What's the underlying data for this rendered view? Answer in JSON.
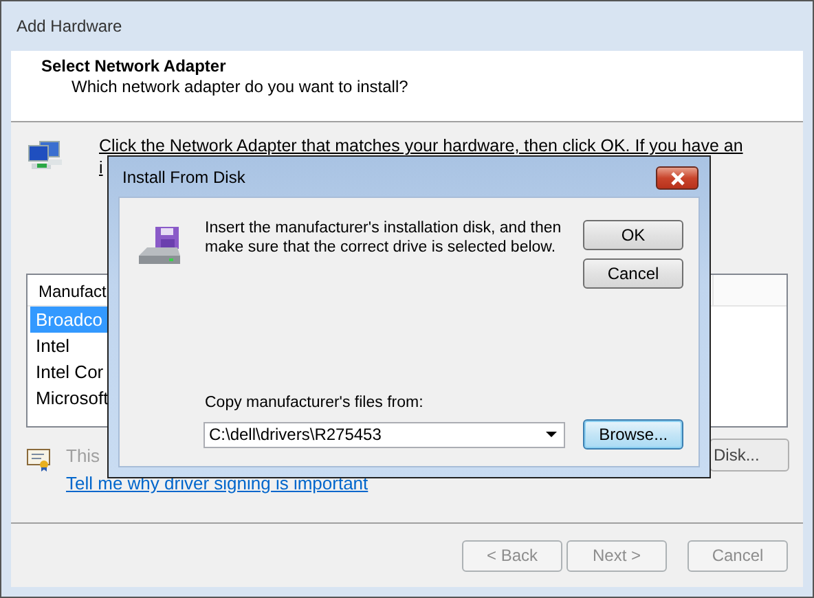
{
  "window": {
    "title": "Add Hardware"
  },
  "header": {
    "title": "Select Network Adapter",
    "subtitle": "Which network adapter do you want to install?"
  },
  "instruction_lines": [
    "Click the Network Adapter that matches your hardware, then click OK. If you have an",
    "i"
  ],
  "manufacturer_list": {
    "column": "Manufact",
    "items": [
      {
        "label": "Broadco",
        "selected": true
      },
      {
        "label": "Intel",
        "selected": false
      },
      {
        "label": "Intel Cor",
        "selected": false
      },
      {
        "label": "Microsoft",
        "selected": false
      }
    ]
  },
  "signing": {
    "text": "This",
    "link": "Tell me why driver signing is important"
  },
  "have_disk_button": {
    "label": "Disk..."
  },
  "buttons": [
    {
      "label": "< Back",
      "disabled": true
    },
    {
      "label": "Next >",
      "disabled": true
    },
    {
      "label": "Cancel",
      "disabled": true
    }
  ],
  "dialog": {
    "title": "Install From Disk",
    "message_lines": [
      "Insert the manufacturer's installation disk, and then",
      "make sure that the correct drive is selected below."
    ],
    "buttons": [
      {
        "label": "OK",
        "focused": false
      },
      {
        "label": "Cancel",
        "focused": false
      }
    ],
    "copy_label": "Copy manufacturer's files from:",
    "path": "C:\\dell\\drivers\\R275453",
    "browse": {
      "label": "Browse...",
      "focused": true
    }
  }
}
